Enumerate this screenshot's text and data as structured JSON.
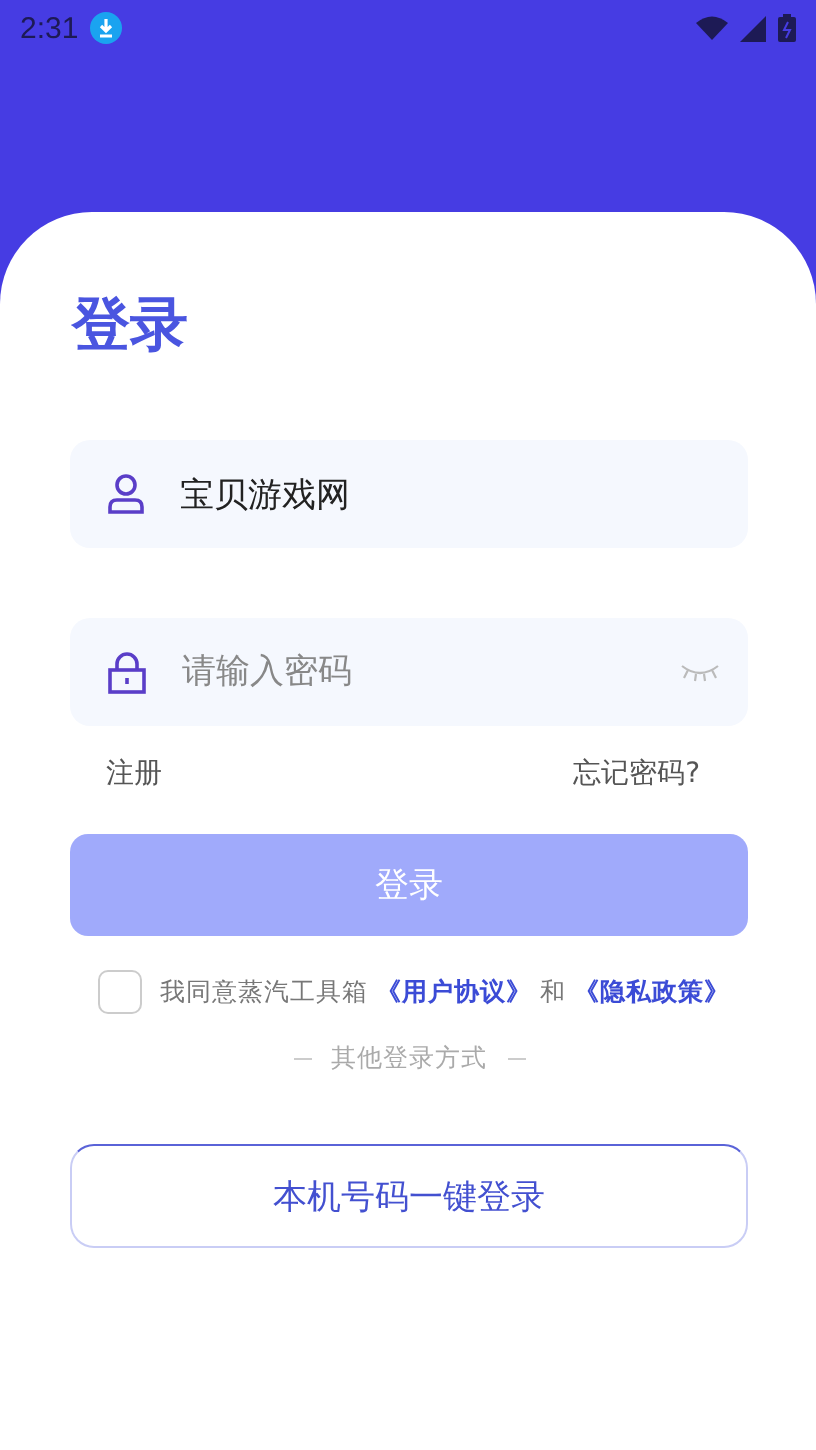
{
  "status_bar": {
    "time": "2:31"
  },
  "title": "登录",
  "username": {
    "value": "宝贝游戏网"
  },
  "password": {
    "placeholder": "请输入密码",
    "visible": false
  },
  "links": {
    "register": "注册",
    "forgot": "忘记密码?"
  },
  "login_button": {
    "label": "登录",
    "disabled": true
  },
  "agreement": {
    "checked": false,
    "parts": [
      {
        "kind": "text",
        "text": "我同意蒸汽工具箱"
      },
      {
        "kind": "link",
        "text": "《用户协议》"
      },
      {
        "kind": "text",
        "text": "和"
      },
      {
        "kind": "link",
        "text": "《隐私政策》"
      }
    ]
  },
  "other_login": {
    "label": "其他登录方式"
  },
  "phone_login": {
    "label": "本机号码一键登录"
  }
}
